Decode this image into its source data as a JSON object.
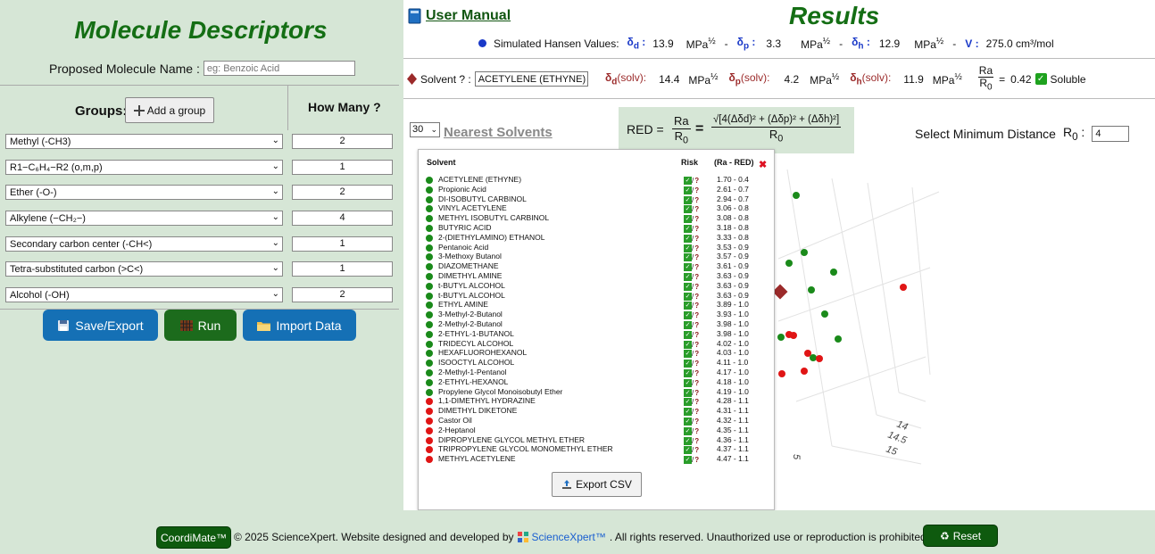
{
  "left": {
    "title": "Molecule Descriptors",
    "name_label": "Proposed Molecule Name :",
    "name_placeholder": "eg: Benzoic Acid",
    "groups_label": "Groups:",
    "add_group_label": "Add a group",
    "how_many_label": "How Many ?",
    "groups": [
      {
        "name": "Methyl (-CH3)",
        "count": "2"
      },
      {
        "name": "R1−C₆H₄−R2 (o,m,p)",
        "count": "1"
      },
      {
        "name": "Ether (-O-)",
        "count": "2"
      },
      {
        "name": "Alkylene (−CH₂−)",
        "count": "4"
      },
      {
        "name": "Secondary carbon center (-CH<)",
        "count": "1"
      },
      {
        "name": "Tetra-substituted carbon (>C<)",
        "count": "1"
      },
      {
        "name": "Alcohol (-OH)",
        "count": "2"
      }
    ],
    "buttons": {
      "save": "Save/Export",
      "run": "Run",
      "import": "Import Data"
    }
  },
  "right": {
    "user_manual": "User Manual",
    "results_title": "Results",
    "hansen_label": "Simulated Hansen Values:",
    "d_val": "13.9",
    "p_val": "3.3",
    "h_val": "12.9",
    "v_label": "V",
    "v_val": "275.0 cm³/mol",
    "unit": "MPa",
    "unit_exp": "½",
    "solvent_label": "Solvent ? :",
    "solvent_value": "ACETYLENE (ETHYNE)",
    "solv_d": "14.4",
    "solv_p": "4.2",
    "solv_h": "11.9",
    "solv_suffix": "(solv):",
    "ra_over_r0": "0.42",
    "soluble_label": "Soluble",
    "nearest_n": "30",
    "nearest_label": "Nearest Solvents",
    "red_label": "RED =",
    "red_formula": "√[4(Δδd)² + (Δδp)² + (Δδh)²]",
    "min_dist_label": "Select Minimum Distance",
    "min_dist_value": "4",
    "table": {
      "col_solvent": "Solvent",
      "col_risk": "Risk",
      "col_ra": "(Ra - RED)",
      "export_label": "Export CSV",
      "rows": [
        {
          "name": "ACETYLENE (ETHYNE)",
          "status": "good",
          "ra": "1.70 - 0.4"
        },
        {
          "name": "Propionic Acid",
          "status": "good",
          "ra": "2.61 - 0.7"
        },
        {
          "name": "DI-ISOBUTYL CARBINOL",
          "status": "good",
          "ra": "2.94 - 0.7"
        },
        {
          "name": "VINYL ACETYLENE",
          "status": "good",
          "ra": "3.06 - 0.8"
        },
        {
          "name": "METHYL ISOBUTYL CARBINOL",
          "status": "good",
          "ra": "3.08 - 0.8"
        },
        {
          "name": "BUTYRIC ACID",
          "status": "good",
          "ra": "3.18 - 0.8"
        },
        {
          "name": "2-(DIETHYLAMINO) ETHANOL",
          "status": "good",
          "ra": "3.33 - 0.8"
        },
        {
          "name": "Pentanoic Acid",
          "status": "good",
          "ra": "3.53 - 0.9"
        },
        {
          "name": "3-Methoxy Butanol",
          "status": "good",
          "ra": "3.57 - 0.9"
        },
        {
          "name": "DIAZOMETHANE",
          "status": "good",
          "ra": "3.61 - 0.9"
        },
        {
          "name": "DIMETHYL AMINE",
          "status": "good",
          "ra": "3.63 - 0.9"
        },
        {
          "name": "t-BUTYL ALCOHOL",
          "status": "good",
          "ra": "3.63 - 0.9"
        },
        {
          "name": "t-BUTYL ALCOHOL",
          "status": "good",
          "ra": "3.63 - 0.9"
        },
        {
          "name": "ETHYL AMINE",
          "status": "good",
          "ra": "3.89 - 1.0"
        },
        {
          "name": "3-Methyl-2-Butanol",
          "status": "good",
          "ra": "3.93 - 1.0"
        },
        {
          "name": "2-Methyl-2-Butanol",
          "status": "good",
          "ra": "3.98 - 1.0"
        },
        {
          "name": "2-ETHYL-1-BUTANOL",
          "status": "good",
          "ra": "3.98 - 1.0"
        },
        {
          "name": "TRIDECYL ALCOHOL",
          "status": "good",
          "ra": "4.02 - 1.0"
        },
        {
          "name": "HEXAFLUOROHEXANOL",
          "status": "good",
          "ra": "4.03 - 1.0"
        },
        {
          "name": "ISOOCTYL ALCOHOL",
          "status": "good",
          "ra": "4.11 - 1.0"
        },
        {
          "name": "2-Methyl-1-Pentanol",
          "status": "good",
          "ra": "4.17 - 1.0"
        },
        {
          "name": "2-ETHYL-HEXANOL",
          "status": "good",
          "ra": "4.18 - 1.0"
        },
        {
          "name": "Propylene Glycol Monoisobutyl Ether",
          "status": "good",
          "ra": "4.19 - 1.0"
        },
        {
          "name": "1,1-DIMETHYL HYDRAZINE",
          "status": "bad",
          "ra": "4.28 - 1.1"
        },
        {
          "name": "DIMETHYL DIKETONE",
          "status": "bad",
          "ra": "4.31 - 1.1"
        },
        {
          "name": "Castor Oil",
          "status": "bad",
          "ra": "4.32 - 1.1"
        },
        {
          "name": "2-Heptanol",
          "status": "bad",
          "ra": "4.35 - 1.1"
        },
        {
          "name": "DIPROPYLENE GLYCOL METHYL ETHER",
          "status": "bad",
          "ra": "4.36 - 1.1"
        },
        {
          "name": "TRIPROPYLENE GLYCOL MONOMETHYL ETHER",
          "status": "bad",
          "ra": "4.37 - 1.1"
        },
        {
          "name": "METHYL ACETYLENE",
          "status": "bad",
          "ra": "4.47 - 1.1"
        }
      ]
    },
    "plot_ticks": [
      "14",
      "14.5",
      "15",
      "5"
    ]
  },
  "footer": {
    "badge": "CoordiMate™",
    "copyright": "© 2025 ScienceXpert. Website designed and developed by",
    "link": "ScienceXpert™",
    "rights": ". All rights reserved. Unauthorized use or reproduction is prohibited.",
    "reset": "Reset"
  },
  "colors": {
    "green": "#1a8a1a",
    "red": "#e01515",
    "accent_blue": "#1570b5",
    "title_green": "#146e14",
    "diamond": "#9b2a2a"
  },
  "icons": [
    "plus-icon",
    "floppy-disk-icon",
    "grid-icon",
    "folder-icon",
    "book-icon",
    "diamond-icon",
    "checkbox-icon",
    "question-icon",
    "close-icon",
    "upload-icon",
    "recycle-icon"
  ]
}
